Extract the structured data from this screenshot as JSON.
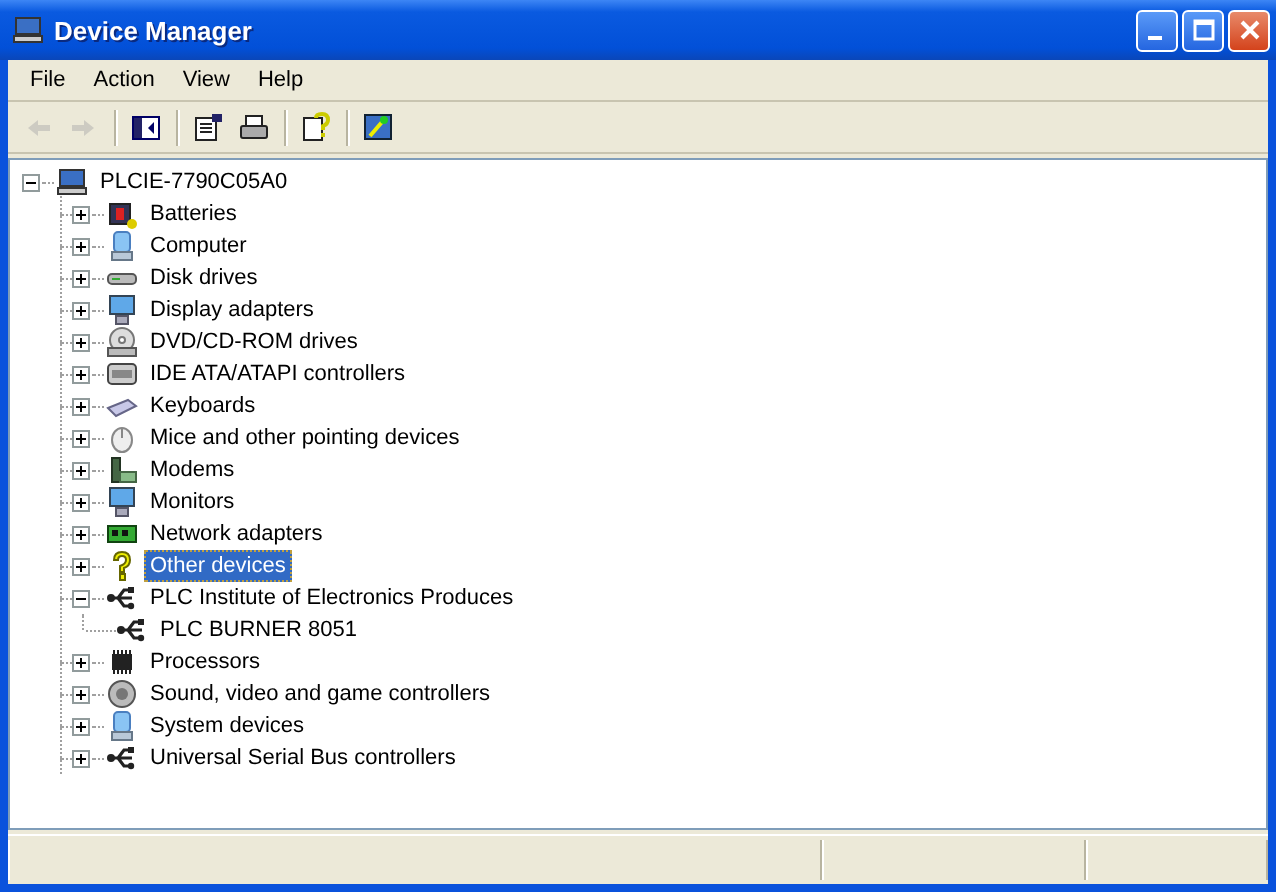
{
  "window": {
    "title": "Device Manager"
  },
  "menu": [
    "File",
    "Action",
    "View",
    "Help"
  ],
  "toolbar": [
    {
      "kind": "button",
      "disabled": true
    },
    {
      "kind": "button",
      "disabled": true
    },
    {
      "kind": "separator"
    },
    {
      "kind": "button",
      "disabled": false
    },
    {
      "kind": "separator"
    },
    {
      "kind": "button",
      "disabled": false
    },
    {
      "kind": "button",
      "disabled": false
    },
    {
      "kind": "separator"
    },
    {
      "kind": "button",
      "disabled": false
    },
    {
      "kind": "separator"
    },
    {
      "kind": "button",
      "disabled": false
    }
  ],
  "tree": {
    "label": "PLCIE-7790C05A0",
    "expanded": true,
    "selected": false,
    "children": [
      {
        "label": "Batteries",
        "expanded": false,
        "selected": false
      },
      {
        "label": "Computer",
        "expanded": false,
        "selected": false
      },
      {
        "label": "Disk drives",
        "expanded": false,
        "selected": false
      },
      {
        "label": "Display adapters",
        "expanded": false,
        "selected": false
      },
      {
        "label": "DVD/CD-ROM drives",
        "expanded": false,
        "selected": false
      },
      {
        "label": "IDE ATA/ATAPI controllers",
        "expanded": false,
        "selected": false
      },
      {
        "label": "Keyboards",
        "expanded": false,
        "selected": false
      },
      {
        "label": "Mice and other pointing devices",
        "expanded": false,
        "selected": false
      },
      {
        "label": "Modems",
        "expanded": false,
        "selected": false
      },
      {
        "label": "Monitors",
        "expanded": false,
        "selected": false
      },
      {
        "label": "Network adapters",
        "expanded": false,
        "selected": false
      },
      {
        "label": "Other devices",
        "expanded": false,
        "selected": true
      },
      {
        "label": "PLC Institute of Electronics Produces",
        "expanded": true,
        "selected": false,
        "children": [
          {
            "label": "PLC BURNER 8051",
            "selected": false
          }
        ]
      },
      {
        "label": "Processors",
        "expanded": false,
        "selected": false
      },
      {
        "label": "Sound, video and game controllers",
        "expanded": false,
        "selected": false
      },
      {
        "label": "System devices",
        "expanded": false,
        "selected": false
      },
      {
        "label": "Universal Serial Bus controllers",
        "expanded": false,
        "selected": false
      }
    ]
  }
}
